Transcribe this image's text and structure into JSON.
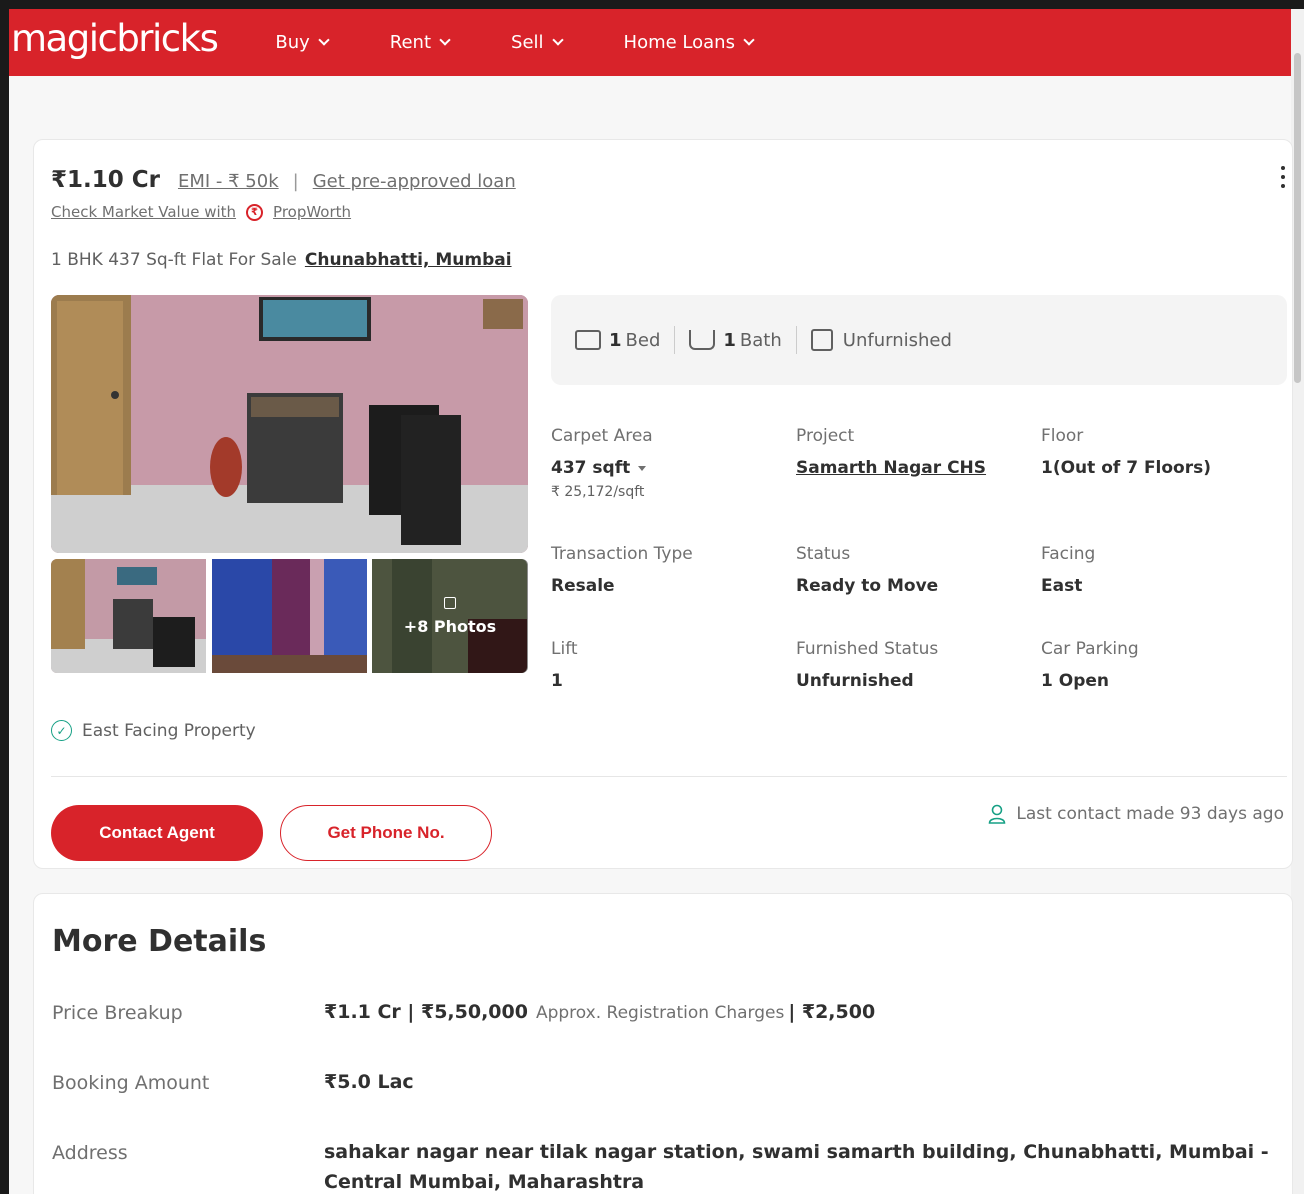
{
  "header": {
    "logo": "magicbricks",
    "nav": [
      {
        "label": "Buy"
      },
      {
        "label": "Rent"
      },
      {
        "label": "Sell"
      },
      {
        "label": "Home Loans"
      }
    ]
  },
  "listing": {
    "price": "₹1.10 Cr",
    "emi": "EMI - ₹ 50k",
    "separator": "|",
    "loan_link": "Get pre-approved loan",
    "market_value_text": "Check Market Value with",
    "propworth": "PropWorth",
    "title": "1 BHK 437 Sq-ft Flat For Sale",
    "location": "Chunabhatti, Mumbai",
    "photos_count": "+8 Photos",
    "summary": {
      "bed_num": "1",
      "bed_label": "Bed",
      "bath_num": "1",
      "bath_label": "Bath",
      "furnishing": "Unfurnished"
    },
    "specs": {
      "carpet_area_label": "Carpet Area",
      "carpet_area_value": "437 sqft",
      "carpet_area_rate": "₹ 25,172/sqft",
      "project_label": "Project",
      "project_value": "Samarth Nagar CHS",
      "floor_label": "Floor",
      "floor_value": "1(Out of 7 Floors)",
      "transaction_label": "Transaction Type",
      "transaction_value": "Resale",
      "status_label": "Status",
      "status_value": "Ready to Move",
      "facing_label": "Facing",
      "facing_value": "East",
      "lift_label": "Lift",
      "lift_value": "1",
      "furnished_label": "Furnished Status",
      "furnished_value": "Unfurnished",
      "parking_label": "Car Parking",
      "parking_value": "1 Open"
    },
    "feature": "East Facing Property",
    "contact_button": "Contact Agent",
    "phone_button": "Get Phone No.",
    "last_contact": "Last contact made 93 days ago"
  },
  "more_details": {
    "title": "More Details",
    "price_breakup_label": "Price Breakup",
    "price_breakup_value": "₹1.1 Cr | ₹5,50,000",
    "registration_text": "Approx. Registration Charges",
    "registration_value": "| ₹2,500",
    "booking_label": "Booking Amount",
    "booking_value": "₹5.0 Lac",
    "address_label": "Address",
    "address_value": "sahakar nagar near tilak nagar station, swami samarth building, Chunabhatti, Mumbai - Central Mumbai, Maharashtra"
  },
  "colors": {
    "brand_red": "#d8232a",
    "success_green": "#16a085"
  }
}
